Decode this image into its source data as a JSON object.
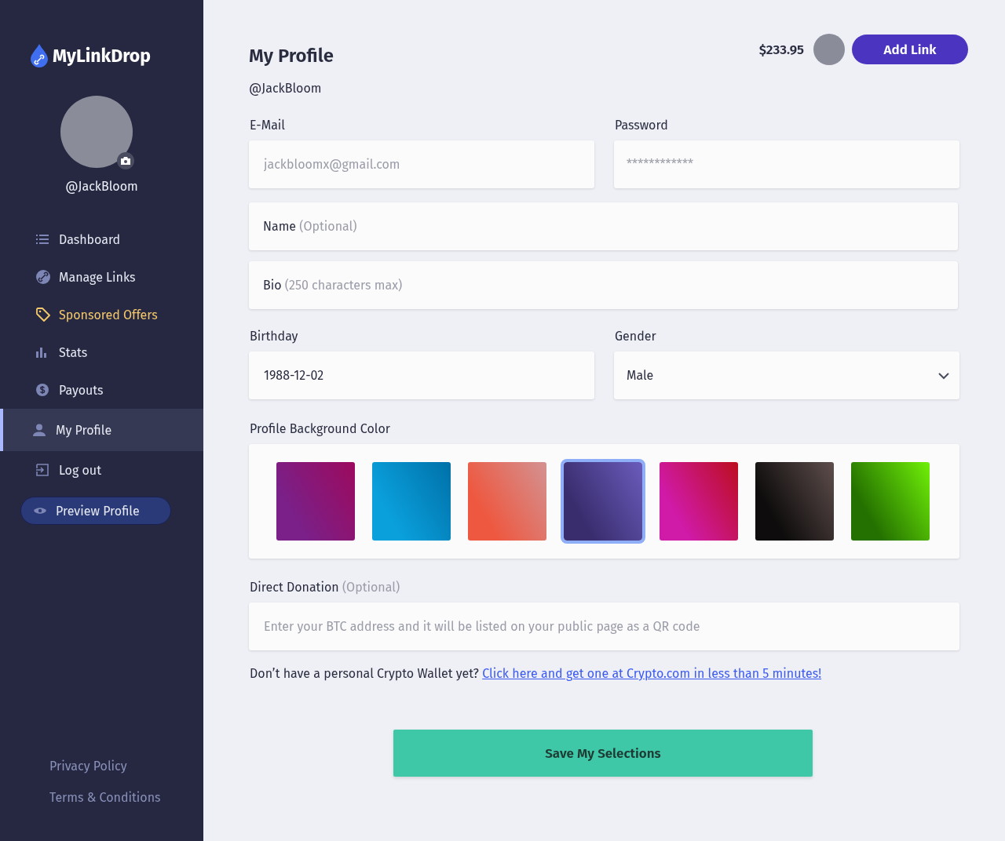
{
  "sidebar": {
    "brand": "MyLinkDrop",
    "username": "@JackBloom",
    "nav": [
      {
        "label": "Dashboard",
        "selected": false,
        "highlighted": false
      },
      {
        "label": "Manage Links",
        "selected": false,
        "highlighted": false
      },
      {
        "label": "Sponsored Offers",
        "selected": false,
        "highlighted": true
      },
      {
        "label": "Stats",
        "selected": false,
        "highlighted": false
      },
      {
        "label": "Payouts",
        "selected": false,
        "highlighted": false
      },
      {
        "label": "My Profile",
        "selected": true,
        "highlighted": false
      },
      {
        "label": "Log out",
        "selected": false,
        "highlighted": false
      }
    ],
    "preview_button": "Preview Profile",
    "footer_links": [
      "Privacy Policy",
      "Terms & Conditions"
    ]
  },
  "header": {
    "title": "My Profile",
    "username": "@JackBloom",
    "balance": "$233.95",
    "add_button": "Add Link"
  },
  "form": {
    "email": {
      "label": "E-Mail",
      "placeholder": "jackbloomx@gmail.com"
    },
    "password": {
      "label": "Password",
      "placeholder": "************"
    },
    "name": {
      "label": "Name",
      "hint": "(Optional)"
    },
    "bio": {
      "label": "Bio",
      "hint": "(250 characters max)"
    },
    "birthday": {
      "label": "Birthday",
      "value": "1988-12-02"
    },
    "gender": {
      "label": "Gender",
      "value": "Male"
    },
    "background_color": {
      "label": "Profile Background Color",
      "swatches": [
        {
          "color": "#7a2088",
          "selected": false
        },
        {
          "color": "#0aa0dc",
          "selected": false
        },
        {
          "color": "#ee5840",
          "selected": false
        },
        {
          "color": "#3a2d6e",
          "selected": true
        },
        {
          "color": "#d01aa8",
          "selected": false
        },
        {
          "color": "#0e0c0c",
          "selected": false
        },
        {
          "color": "#247000",
          "selected": false
        }
      ]
    },
    "donation": {
      "label": "Direct Donation",
      "hint": "(Optional)",
      "placeholder": "Enter your BTC address and it will be listed on your public page as a QR code"
    },
    "wallet_note": {
      "text": "Don’t have a personal Crypto Wallet yet?",
      "link": "Click here and get one at Crypto.com in less than 5 minutes!"
    },
    "save_button": "Save My Selections"
  }
}
